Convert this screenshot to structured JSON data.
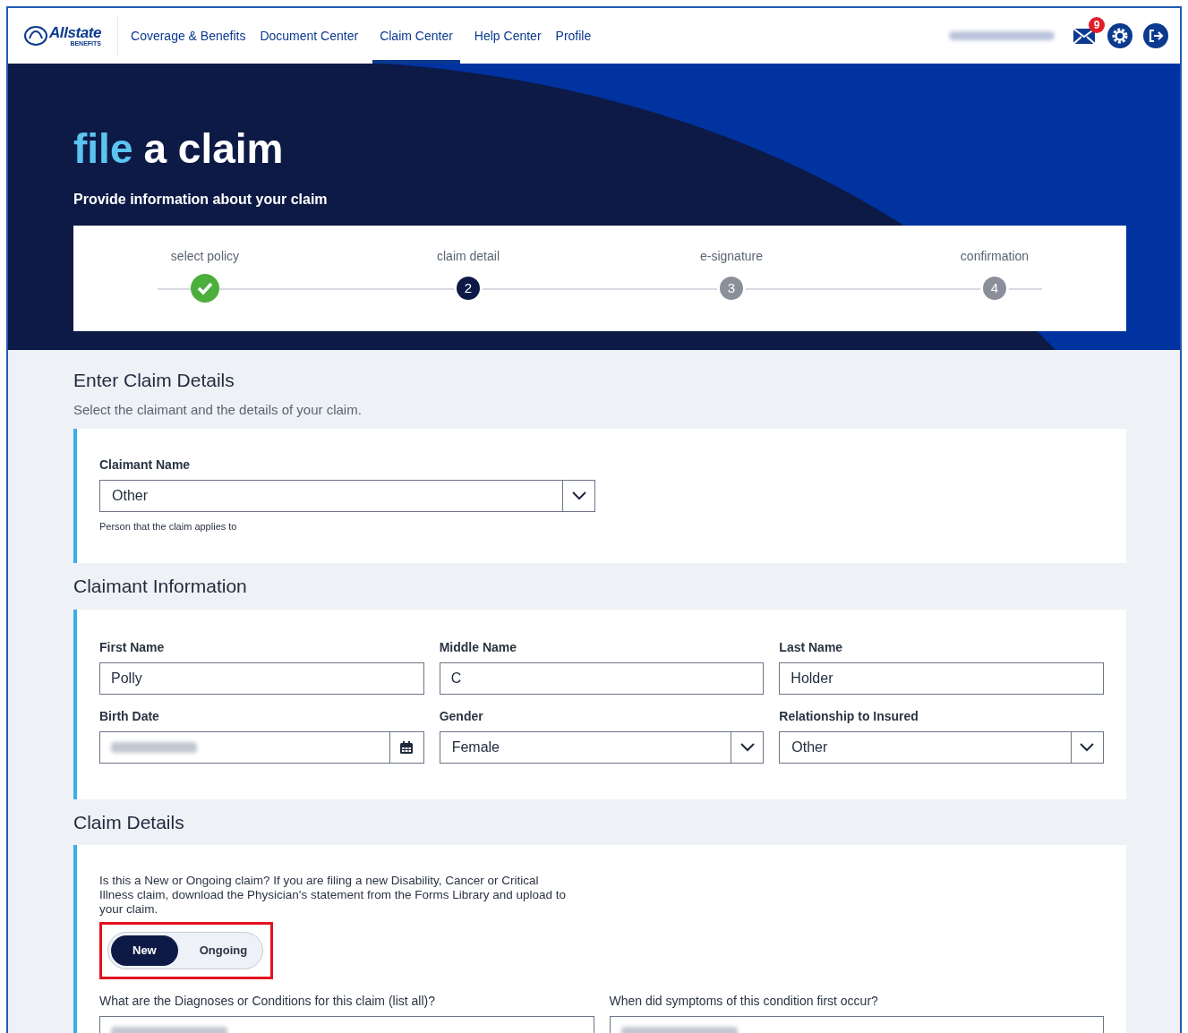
{
  "nav": {
    "logo_text": "Allstate",
    "logo_subtext": "BENEFITS",
    "links": [
      {
        "label": "Coverage & Benefits",
        "selected": false
      },
      {
        "label": "Document Center",
        "selected": false
      },
      {
        "label": "Claim Center",
        "selected": true
      },
      {
        "label": "Help Center",
        "selected": false
      },
      {
        "label": "Profile",
        "selected": false
      }
    ],
    "mail_badge": "9"
  },
  "hero": {
    "title_accent": "file",
    "title_rest": "a claim",
    "subtitle": "Provide information about your claim"
  },
  "steps": [
    {
      "label": "select policy",
      "completed": true,
      "current": false
    },
    {
      "label": "claim detail",
      "number": "2",
      "completed": false,
      "current": true
    },
    {
      "label": "e-signature",
      "number": "3",
      "completed": false,
      "current": false
    },
    {
      "label": "confirmation",
      "number": "4",
      "completed": false,
      "current": false
    }
  ],
  "enter_claim": {
    "heading": "Enter Claim Details",
    "description": "Select the claimant and the details of your claim.",
    "claimant_label": "Claimant Name",
    "claimant_value": "Other",
    "claimant_hint": "Person that the claim applies to"
  },
  "claimant_info": {
    "heading": "Claimant Information",
    "fields": [
      {
        "kind": "text",
        "label": "First Name",
        "value": "Polly"
      },
      {
        "kind": "text",
        "label": "Middle Name",
        "value": "C"
      },
      {
        "kind": "text",
        "label": "Last Name",
        "value": "Holder"
      },
      {
        "kind": "date",
        "label": "Birth Date",
        "redacted": true
      },
      {
        "kind": "select",
        "label": "Gender",
        "value": "Female"
      },
      {
        "kind": "select",
        "label": "Relationship to Insured",
        "value": "Other"
      }
    ]
  },
  "claim_details": {
    "heading": "Claim Details",
    "question": "Is this a New or Ongoing claim? If you are filing a new Disability, Cancer or Critical Illness claim, download the Physician's statement from the Forms Library and upload to your claim.",
    "toggle": [
      {
        "label": "New",
        "selected": true
      },
      {
        "label": "Ongoing",
        "selected": false
      }
    ],
    "fields": [
      {
        "label": "What are the Diagnoses or Conditions for this claim (list all)?",
        "redacted": true
      },
      {
        "label": "When did symptoms of this condition first occur?",
        "redacted": true
      }
    ]
  }
}
